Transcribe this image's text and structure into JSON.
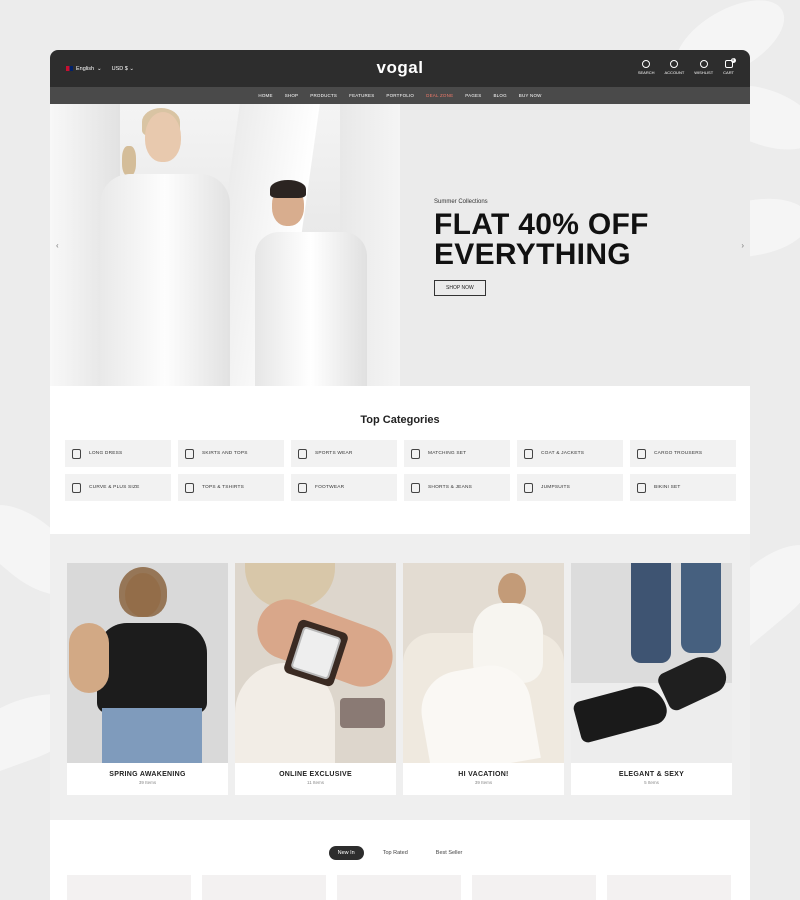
{
  "header": {
    "language": "English",
    "currency": "USD $",
    "logo": "vogal",
    "icons": [
      {
        "icon": "search-icon",
        "label": "SEARCH"
      },
      {
        "icon": "account-icon",
        "label": "ACCOUNT"
      },
      {
        "icon": "heart-icon",
        "label": "WISHLIST"
      },
      {
        "icon": "cart-icon",
        "label": "CART",
        "badge": "0"
      }
    ]
  },
  "nav": {
    "items": [
      "HOME",
      "SHOP",
      "PRODUCTS",
      "FEATURES",
      "PORTFOLIO",
      "DEAL ZONE",
      "PAGES",
      "BLOG",
      "BUY NOW"
    ],
    "highlight_color": "#f07a6a"
  },
  "hero": {
    "subtitle": "Summer Collections",
    "title_line1": "FLAT 40% OFF",
    "title_line2": "EVERYTHING",
    "button": "SHOP NOW",
    "prev": "‹",
    "next": "›"
  },
  "categories": {
    "title": "Top Categories",
    "items": [
      "LONG DRESS",
      "SKIRTS AND TOPS",
      "SPORTS WEAR",
      "MATCHING SET",
      "COAT & JACKETS",
      "CARGO TROUSERS",
      "CURVE & PLUS SIZE",
      "TOPS & TSHIRTS",
      "FOOTWEAR",
      "SHORTS & JEANS",
      "JUMPSUITS",
      "BIKINI SET"
    ]
  },
  "collections": [
    {
      "name": "SPRING AWAKENING",
      "count": "39 Items"
    },
    {
      "name": "ONLINE EXCLUSIVE",
      "count": "11 Items"
    },
    {
      "name": "HI VACATION!",
      "count": "39 Items"
    },
    {
      "name": "ELEGANT & SEXY",
      "count": "5 Items"
    }
  ],
  "products": {
    "tabs": [
      "New In",
      "Top Rated",
      "Best Seller"
    ],
    "active_tab": "New In"
  }
}
